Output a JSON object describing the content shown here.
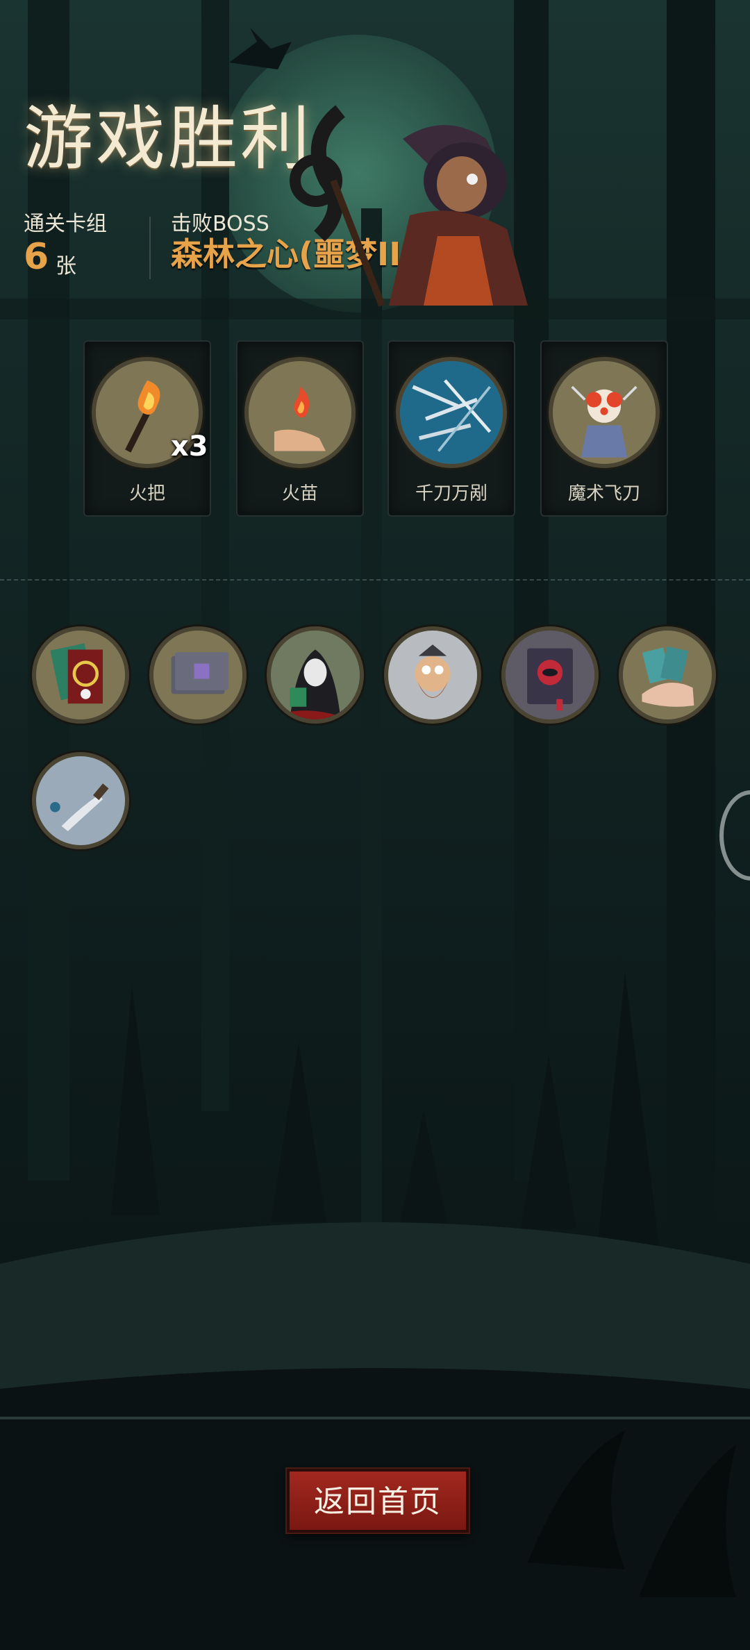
{
  "title": "游戏胜利",
  "stats": {
    "deck_label": "通关卡组",
    "deck_count": "6",
    "deck_unit": "张",
    "boss_label": "击败BOSS",
    "boss_name": "森林之心(噩梦III)"
  },
  "cards": [
    {
      "name": "火把",
      "qty": "x3",
      "icon": "torch-icon"
    },
    {
      "name": "火苗",
      "qty": "",
      "icon": "flame-hand-icon"
    },
    {
      "name": "千刀万剐",
      "qty": "",
      "icon": "blades-icon"
    },
    {
      "name": "魔术飞刀",
      "qty": "",
      "icon": "clown-knives-icon"
    }
  ],
  "relics": [
    {
      "icon": "skull-card-icon"
    },
    {
      "icon": "card-stack-icon"
    },
    {
      "icon": "hooded-figure-icon"
    },
    {
      "icon": "bearded-man-icon"
    },
    {
      "icon": "red-book-icon"
    },
    {
      "icon": "card-hand-icon"
    },
    {
      "icon": "knife-icon"
    }
  ],
  "home_button": "返回首页",
  "colors": {
    "accent": "#e6a34a",
    "button": "#8e1f17",
    "title": "#f4ead2"
  }
}
